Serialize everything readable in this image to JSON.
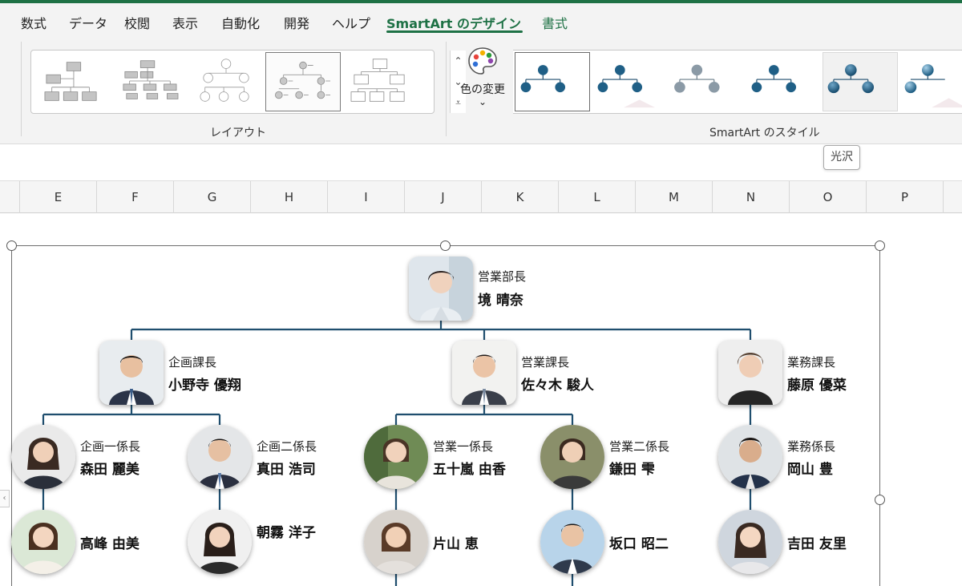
{
  "tabs": [
    {
      "label": "数式"
    },
    {
      "label": "データ"
    },
    {
      "label": "校閲"
    },
    {
      "label": "表示"
    },
    {
      "label": "自動化"
    },
    {
      "label": "開発"
    },
    {
      "label": "ヘルプ"
    },
    {
      "label": "SmartArt のデザイン",
      "active": true
    },
    {
      "label": "書式"
    }
  ],
  "ribbon": {
    "layout_group_label": "レイアウト",
    "color_change_label": "色の変更",
    "styles_group_label": "SmartArt のスタイル",
    "tooltip": "光沢"
  },
  "colors": {
    "accent_green": "#1e7145",
    "node_blue": "#1f5f86",
    "connector": "#1f4e6e"
  },
  "columns": [
    "E",
    "F",
    "G",
    "H",
    "I",
    "J",
    "K",
    "L",
    "M",
    "N",
    "O",
    "P"
  ],
  "org": {
    "top": {
      "title": "営業部長",
      "name": "境 晴奈"
    },
    "managers": [
      {
        "title": "企画課長",
        "name": "小野寺 優翔"
      },
      {
        "title": "営業課長",
        "name": "佐々木 駿人"
      },
      {
        "title": "業務課長",
        "name": "藤原 優菜"
      }
    ],
    "chiefs": [
      {
        "title": "企画一係長",
        "name": "森田 麗美"
      },
      {
        "title": "企画二係長",
        "name": "真田 浩司"
      },
      {
        "title": "営業一係長",
        "name": "五十嵐 由香"
      },
      {
        "title": "営業二係長",
        "name": "鎌田 雫"
      },
      {
        "title": "業務係長",
        "name": "岡山 豊"
      }
    ],
    "staff": [
      {
        "name": "高峰 由美"
      },
      {
        "name": "朝霧 洋子"
      },
      {
        "name": "片山 恵"
      },
      {
        "name": "坂口 昭二"
      },
      {
        "name": "吉田 友里"
      }
    ]
  }
}
